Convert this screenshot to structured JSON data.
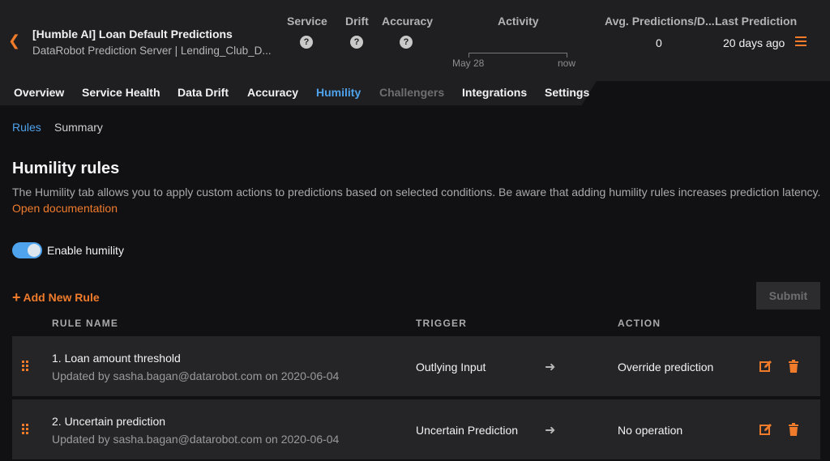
{
  "header": {
    "title": "[Humble AI] Loan Default Predictions",
    "subtitle": "DataRobot Prediction Server | Lending_Club_D...",
    "columns": {
      "service": "Service",
      "drift": "Drift",
      "accuracy": "Accuracy",
      "activity": "Activity",
      "avg_predictions": "Avg. Predictions/D...",
      "last_prediction": "Last Prediction"
    },
    "status_icons": {
      "service": "question-circle-icon",
      "drift": "question-circle-icon",
      "accuracy": "question-circle-icon"
    },
    "activity_start": "May 28",
    "activity_end": "now",
    "avg_predictions_value": "0",
    "last_prediction_value": "20 days ago"
  },
  "tabs": [
    {
      "label": "Overview"
    },
    {
      "label": "Service Health"
    },
    {
      "label": "Data Drift"
    },
    {
      "label": "Accuracy"
    },
    {
      "label": "Humility",
      "active": true
    },
    {
      "label": "Challengers",
      "disabled": true
    },
    {
      "label": "Integrations"
    },
    {
      "label": "Settings"
    }
  ],
  "breadcrumb": {
    "rules": "Rules",
    "summary": "Summary"
  },
  "page": {
    "title": "Humility rules",
    "description": "The Humility tab allows you to apply custom actions to predictions based on selected conditions. Be aware that adding humility rules increases prediction latency.",
    "doc_link": "Open documentation"
  },
  "toggle": {
    "label": "Enable humility",
    "enabled": true
  },
  "actions": {
    "add_rule": "Add New Rule",
    "submit": "Submit"
  },
  "table": {
    "headers": {
      "name": "RULE NAME",
      "trigger": "TRIGGER",
      "action": "ACTION"
    },
    "rows": [
      {
        "name": "1. Loan amount threshold",
        "meta": "Updated by sasha.bagan@datarobot.com on 2020-06-04",
        "trigger": "Outlying Input",
        "action": "Override prediction"
      },
      {
        "name": "2. Uncertain prediction",
        "meta": "Updated by sasha.bagan@datarobot.com on 2020-06-04",
        "trigger": "Uncertain Prediction",
        "action": "No operation"
      }
    ]
  },
  "colors": {
    "accent": "#f07b2b",
    "link": "#4fa3ec",
    "background": "#111114",
    "panel": "#1f1f21",
    "row": "#252527"
  }
}
